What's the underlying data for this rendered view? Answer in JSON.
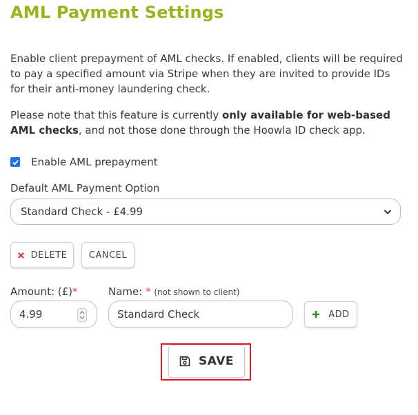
{
  "page": {
    "title": "AML Payment Settings",
    "description": "Enable client prepayment of AML checks. If enabled, clients will be required to pay a specified amount via Stripe when they are invited to provide IDs for their anti-money laundering check.",
    "note_prefix": "Please note that this feature is currently ",
    "note_bold": "only available for web-based AML checks",
    "note_suffix": ", and not those done through the Hoowla ID check app."
  },
  "prepayment": {
    "label": "Enable AML prepayment",
    "checked": true
  },
  "payment_option": {
    "label": "Default AML Payment Option",
    "selected": "Standard Check - £4.99"
  },
  "actions": {
    "delete_label": "DELETE",
    "cancel_label": "CANCEL",
    "add_label": "ADD",
    "save_label": "SAVE"
  },
  "amount": {
    "label": "Amount: (£)",
    "required_mark": "*",
    "value": "4.99"
  },
  "name": {
    "label": "Name: ",
    "required_mark": "*",
    "hint": "(not shown to client)",
    "value": "Standard Check"
  },
  "colors": {
    "title": "#9ab51a",
    "checkbox": "#1a73e8",
    "required": "#e0463a",
    "delete_icon": "#e0463a",
    "add_icon": "#2e8b1e",
    "highlight": "#d91c24"
  },
  "icons": {
    "delete": "close-icon",
    "add": "plus-icon",
    "save": "floppy-disk-icon",
    "select": "chevron-down-icon"
  }
}
